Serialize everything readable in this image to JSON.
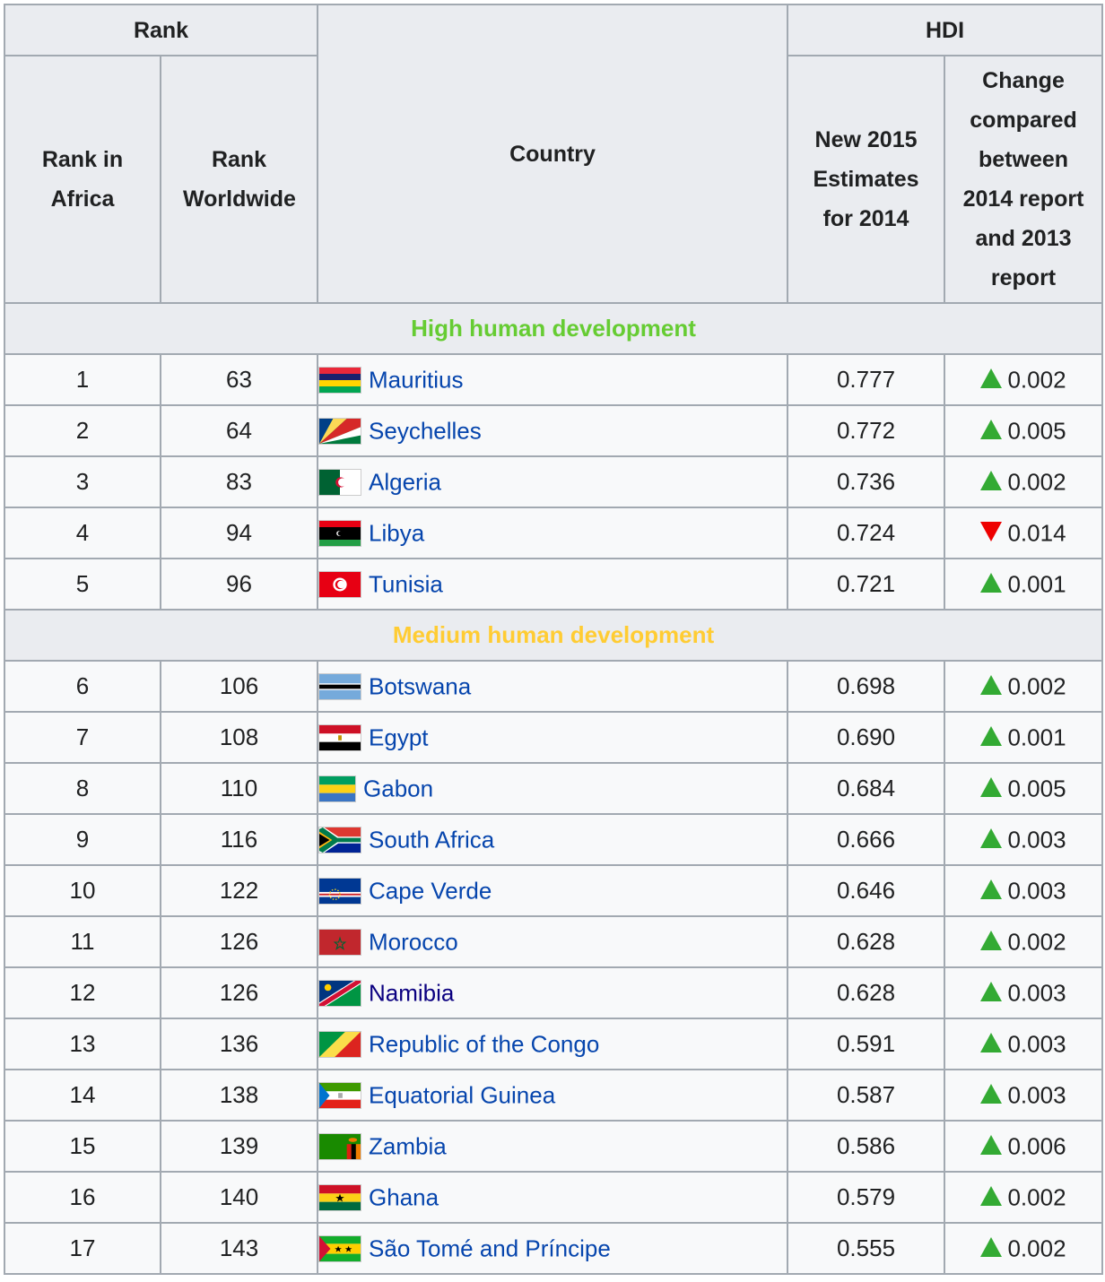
{
  "headers": {
    "rank_group": "Rank",
    "country": "Country",
    "hdi_group": "HDI",
    "rank_africa": "Rank in Africa",
    "rank_world": "Rank Worldwide",
    "hdi_2014": "New 2015 Estimates for 2014",
    "hdi_change": "Change compared between 2014 report and 2013 report"
  },
  "sections": [
    {
      "title": "High human development",
      "color": "#66cc33",
      "rows": [
        {
          "rank_africa": "1",
          "rank_world": "63",
          "country": "Mauritius",
          "flag": "mauritius",
          "hdi": "0.777",
          "trend": "up",
          "change": "0.002"
        },
        {
          "rank_africa": "2",
          "rank_world": "64",
          "country": "Seychelles",
          "flag": "seychelles",
          "hdi": "0.772",
          "trend": "up",
          "change": "0.005"
        },
        {
          "rank_africa": "3",
          "rank_world": "83",
          "country": "Algeria",
          "flag": "algeria",
          "hdi": "0.736",
          "trend": "up",
          "change": "0.002"
        },
        {
          "rank_africa": "4",
          "rank_world": "94",
          "country": "Libya",
          "flag": "libya",
          "hdi": "0.724",
          "trend": "down",
          "change": "0.014"
        },
        {
          "rank_africa": "5",
          "rank_world": "96",
          "country": "Tunisia",
          "flag": "tunisia",
          "hdi": "0.721",
          "trend": "up",
          "change": "0.001"
        }
      ]
    },
    {
      "title": "Medium human development",
      "color": "#ffcc33",
      "rows": [
        {
          "rank_africa": "6",
          "rank_world": "106",
          "country": "Botswana",
          "flag": "botswana",
          "hdi": "0.698",
          "trend": "up",
          "change": "0.002"
        },
        {
          "rank_africa": "7",
          "rank_world": "108",
          "country": "Egypt",
          "flag": "egypt",
          "hdi": "0.690",
          "trend": "up",
          "change": "0.001"
        },
        {
          "rank_africa": "8",
          "rank_world": "110",
          "country": "Gabon",
          "flag": "gabon",
          "hdi": "0.684",
          "trend": "up",
          "change": "0.005"
        },
        {
          "rank_africa": "9",
          "rank_world": "116",
          "country": "South Africa",
          "flag": "south-africa",
          "hdi": "0.666",
          "trend": "up",
          "change": "0.003"
        },
        {
          "rank_africa": "10",
          "rank_world": "122",
          "country": "Cape Verde",
          "flag": "cape-verde",
          "hdi": "0.646",
          "trend": "up",
          "change": "0.003"
        },
        {
          "rank_africa": "11",
          "rank_world": "126",
          "country": "Morocco",
          "flag": "morocco",
          "hdi": "0.628",
          "trend": "up",
          "change": "0.002"
        },
        {
          "rank_africa": "12",
          "rank_world": "126",
          "country": "Namibia",
          "flag": "namibia",
          "hdi": "0.628",
          "trend": "up",
          "change": "0.003"
        },
        {
          "rank_africa": "13",
          "rank_world": "136",
          "country": "Republic of the Congo",
          "flag": "congo",
          "hdi": "0.591",
          "trend": "up",
          "change": "0.003"
        },
        {
          "rank_africa": "14",
          "rank_world": "138",
          "country": "Equatorial Guinea",
          "flag": "equatorial-guinea",
          "hdi": "0.587",
          "trend": "up",
          "change": "0.003"
        },
        {
          "rank_africa": "15",
          "rank_world": "139",
          "country": "Zambia",
          "flag": "zambia",
          "hdi": "0.586",
          "trend": "up",
          "change": "0.006"
        },
        {
          "rank_africa": "16",
          "rank_world": "140",
          "country": "Ghana",
          "flag": "ghana",
          "hdi": "0.579",
          "trend": "up",
          "change": "0.002"
        },
        {
          "rank_africa": "17",
          "rank_world": "143",
          "country": "São Tomé and Príncipe",
          "flag": "sao-tome",
          "hdi": "0.555",
          "trend": "up",
          "change": "0.002"
        }
      ]
    }
  ]
}
